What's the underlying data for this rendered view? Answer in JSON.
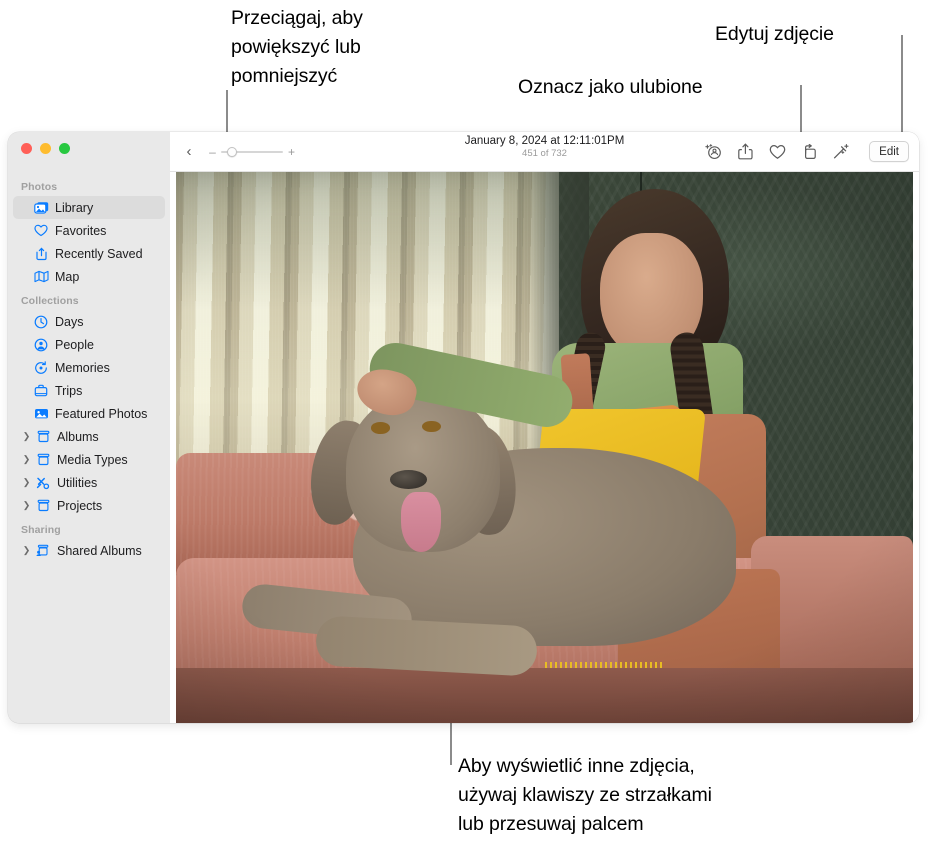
{
  "callouts": [
    {
      "id": "zoom-hint",
      "text": "Przeciągaj, aby\npowiększyć lub\npomniejszyć"
    },
    {
      "id": "favorite-hint",
      "text": "Oznacz jako ulubione"
    },
    {
      "id": "edit-hint",
      "text": "Edytuj zdjęcie"
    },
    {
      "id": "navigate-hint",
      "text": "Aby wyświetlić inne zdjęcia,\nużywaj klawiszy ze strzałkami\nlub przesuwaj palcem"
    }
  ],
  "window": {
    "traffic_lights": {
      "close": "close-button",
      "minimize": "minimize-button",
      "zoom": "zoom-button"
    }
  },
  "sidebar": {
    "sections": [
      {
        "header": "Photos",
        "items": [
          {
            "label": "Library",
            "icon": "library-icon",
            "selected": true,
            "disclosure": false
          },
          {
            "label": "Favorites",
            "icon": "heart-icon",
            "selected": false,
            "disclosure": false
          },
          {
            "label": "Recently Saved",
            "icon": "recently-saved-icon",
            "selected": false,
            "disclosure": false
          },
          {
            "label": "Map",
            "icon": "map-icon",
            "selected": false,
            "disclosure": false
          }
        ]
      },
      {
        "header": "Collections",
        "items": [
          {
            "label": "Days",
            "icon": "clock-icon",
            "selected": false,
            "disclosure": false
          },
          {
            "label": "People",
            "icon": "person-icon",
            "selected": false,
            "disclosure": false
          },
          {
            "label": "Memories",
            "icon": "memories-icon",
            "selected": false,
            "disclosure": false
          },
          {
            "label": "Trips",
            "icon": "suitcase-icon",
            "selected": false,
            "disclosure": false
          },
          {
            "label": "Featured Photos",
            "icon": "featured-photos-icon",
            "selected": false,
            "disclosure": false
          },
          {
            "label": "Albums",
            "icon": "album-icon",
            "selected": false,
            "disclosure": true
          },
          {
            "label": "Media Types",
            "icon": "album-icon",
            "selected": false,
            "disclosure": true
          },
          {
            "label": "Utilities",
            "icon": "utilities-icon",
            "selected": false,
            "disclosure": true
          },
          {
            "label": "Projects",
            "icon": "album-icon",
            "selected": false,
            "disclosure": true
          }
        ]
      },
      {
        "header": "Sharing",
        "items": [
          {
            "label": "Shared Albums",
            "icon": "shared-album-icon",
            "selected": false,
            "disclosure": true
          }
        ]
      }
    ]
  },
  "toolbar": {
    "back_label": "‹",
    "zoom_minus": "–",
    "zoom_plus": "+",
    "zoom_value": "10",
    "title": "January 8, 2024 at 12:11:01PM",
    "subtitle": "451 of 732",
    "actions": [
      {
        "name": "add-to-album-icon",
        "label": "Add To"
      },
      {
        "name": "share-icon",
        "label": "Share"
      },
      {
        "name": "favorite-icon",
        "label": "Favorite"
      },
      {
        "name": "rotate-icon",
        "label": "Rotate"
      },
      {
        "name": "enhance-icon",
        "label": "Enhance"
      }
    ],
    "edit_label": "Edit"
  },
  "colors": {
    "accent_blue": "#0a7cff",
    "sidebar_bg": "#e9e9e9",
    "selection_bg": "#dcdcdc",
    "callout_line": "#8b8b8b",
    "traffic_red": "#ff5f57",
    "traffic_yellow": "#febc2e",
    "traffic_green": "#28c840"
  },
  "photo": {
    "alt": "Girl petting a Weimaraner dog on a pink couch"
  }
}
